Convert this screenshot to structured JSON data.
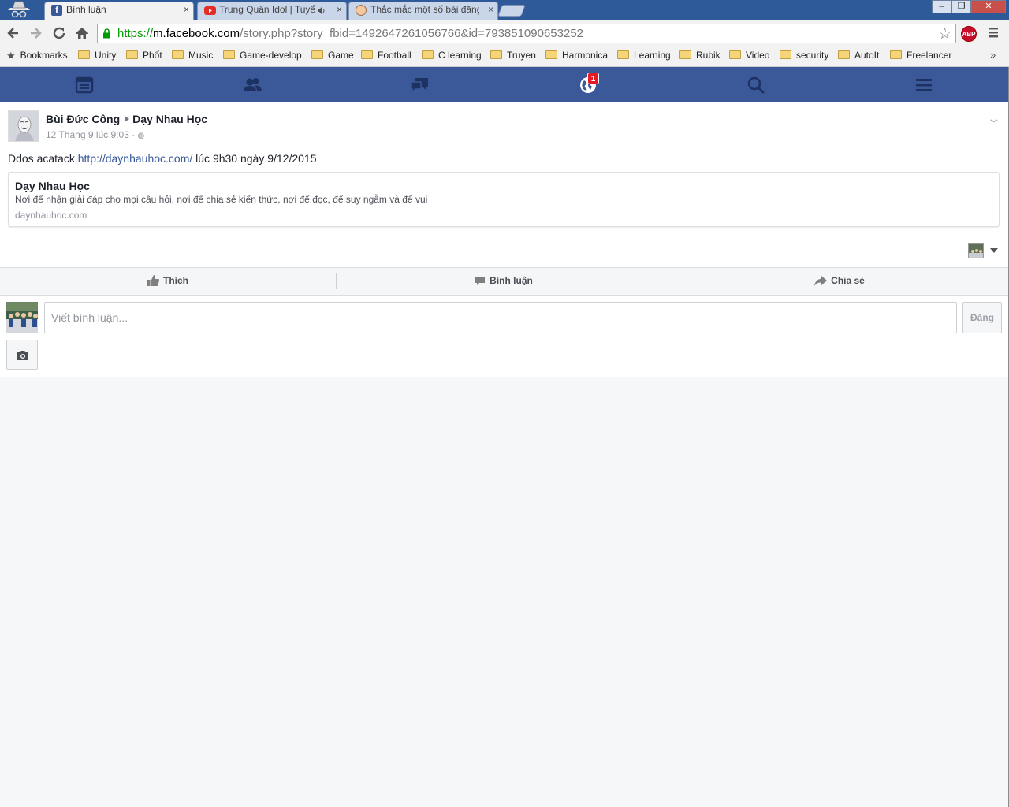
{
  "browser": {
    "tabs": [
      {
        "label": "Bình luận",
        "close": "×",
        "icon": "facebook-icon",
        "active": true
      },
      {
        "label": "Trung Quân Idol | Tuyể",
        "close": "×",
        "icon": "youtube-icon",
        "active": false,
        "audio": "speaker-icon"
      },
      {
        "label": "Thắc mắc một số bài đăng",
        "close": "×",
        "icon": "face-avatar-icon",
        "active": false
      }
    ],
    "window_controls": [
      "–",
      "❐",
      "✕"
    ],
    "url": {
      "scheme": "https://",
      "host": "m.facebook.com",
      "path": "/story.php?story_fbid=1492647261056766&id=793851090653252"
    },
    "extension_label": "ABP",
    "bookmarks": [
      {
        "label": "Bookmarks",
        "icon": "star-icon"
      },
      {
        "label": "Unity",
        "icon": "folder-icon"
      },
      {
        "label": "Phốt",
        "icon": "folder-icon"
      },
      {
        "label": "Music",
        "icon": "folder-icon"
      },
      {
        "label": "Game-develop",
        "icon": "folder-icon"
      },
      {
        "label": "Game",
        "icon": "folder-icon"
      },
      {
        "label": "Football",
        "icon": "folder-icon"
      },
      {
        "label": "C learning",
        "icon": "folder-icon"
      },
      {
        "label": "Truyen",
        "icon": "folder-icon"
      },
      {
        "label": "Harmonica",
        "icon": "folder-icon"
      },
      {
        "label": "Learning",
        "icon": "folder-icon"
      },
      {
        "label": "Rubik",
        "icon": "folder-icon"
      },
      {
        "label": "Video",
        "icon": "folder-icon"
      },
      {
        "label": "security",
        "icon": "folder-icon"
      },
      {
        "label": "AutoIt",
        "icon": "folder-icon"
      },
      {
        "label": "Freelancer",
        "icon": "folder-icon"
      }
    ],
    "bookmarks_more": "»"
  },
  "fb": {
    "colors": {
      "brand": "#3b5998",
      "link": "#365899",
      "badge": "#e41b23"
    },
    "nav_icons": [
      "news-feed-icon",
      "friends-icon",
      "messages-icon",
      "notifications-globe-icon",
      "search-icon",
      "menu-icon"
    ],
    "notification_count": "1",
    "story": {
      "author": "Bùi Đức Công",
      "group": "Dạy Nhau Học",
      "timestamp": "12 Tháng 9 lúc 9:03 · ",
      "text_before": "Ddos acatack ",
      "link": "http://daynhauhoc.com/",
      "text_after": " lúc 9h30 ngày 9/12/2015",
      "card": {
        "title": "Dạy Nhau Học",
        "description": "Nơi để nhận giải đáp cho mọi câu hỏi, nơi để chia sẻ kiến thức, nơi để đọc, để suy ngẫm và để vui",
        "domain": "daynhauhoc.com"
      }
    },
    "actions": {
      "like": "Thích",
      "comment": "Bình luận",
      "share": "Chia sẻ"
    },
    "composer": {
      "placeholder": "Viết bình luận...",
      "post": "Đăng"
    }
  }
}
